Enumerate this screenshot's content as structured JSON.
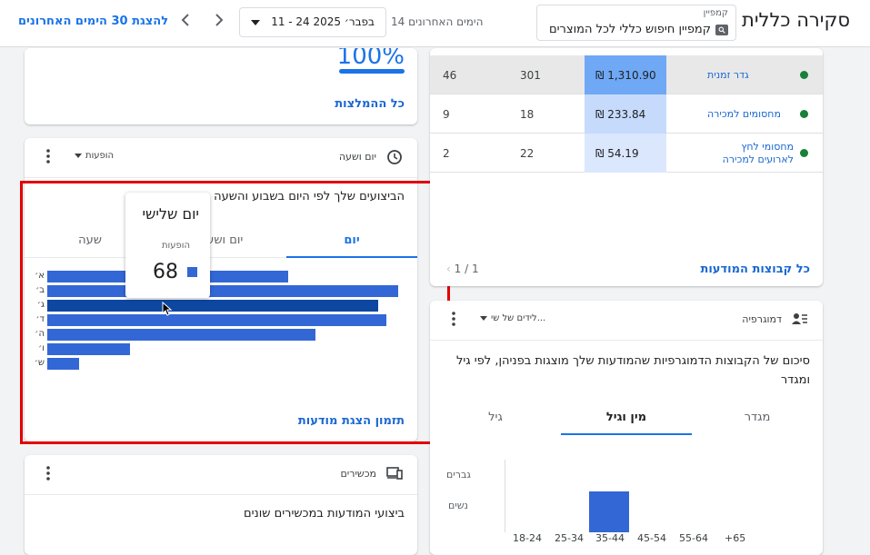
{
  "header": {
    "title": "סקירה כללית",
    "campaign_caption": "קמפיין",
    "campaign_value": "קמפיין חיפוש כללי לכל המוצרים",
    "range_caption": "14 הימים האחרונים",
    "date_range": "11 - 24 בפבר׳ 2025",
    "last30_link": "להצגת 30 הימים האחרונים"
  },
  "card_optimization": {
    "value": "100%",
    "link": "כל ההמלצות"
  },
  "card_schedule": {
    "header_title": "יום ושעה",
    "metric_select": "הופעות",
    "title": "הביצועים שלך לפי היום בשבוע והשעה",
    "tabs": [
      "יום",
      "יום ושעה",
      "שעה"
    ],
    "tooltip": {
      "title": "יום שלישי",
      "label": "הופעות",
      "value": "68"
    },
    "link": "תזמון הצגת מודעות"
  },
  "chart_data": {
    "type": "bar",
    "orientation": "horizontal",
    "categories": [
      "א׳",
      "ב׳",
      "ג׳",
      "ד׳",
      "ה׳",
      "ו׳",
      "ש׳"
    ],
    "values": [
      61,
      89,
      84,
      86,
      68,
      21,
      8
    ],
    "series": [
      {
        "name": "הופעות",
        "values": [
          61,
          89,
          84,
          86,
          68,
          21,
          8
        ]
      }
    ],
    "highlighted_index": 2,
    "color": "#3367d6",
    "highlight_color": "#0d47a1"
  },
  "card_devices": {
    "header_title": "מכשירים",
    "title": "ביצועי המודעות במכשירים שונים"
  },
  "card_adgroups": {
    "rows": [
      {
        "name": "גדר זמנית",
        "cost": "₪ 1,310.90",
        "col2": "301",
        "col1": "46",
        "cost_color": "#6fa8f5"
      },
      {
        "name": "מחסומים למכירה",
        "cost": "₪ 233.84",
        "col2": "18",
        "col1": "9",
        "cost_color": "#c6dafc"
      },
      {
        "name": "מחסומי לחץ לארועים למכירה",
        "cost": "₪ 54.19",
        "col2": "22",
        "col1": "2",
        "cost_color": "#dbe7fd"
      }
    ],
    "pager": "1 / 1",
    "link": "כל קבוצות המודעות"
  },
  "card_demographics": {
    "header_title": "דמוגרפיה",
    "metric_select": "לידים של שי...",
    "title": "סיכום של הקבוצות הדמוגרפיות שהמודעות שלך מוצגות בפניהן, לפי גיל ומגדר",
    "tabs": [
      "מגדר",
      "מין וגיל",
      "גיל"
    ],
    "gender_labels": [
      "גברים",
      "נשים"
    ],
    "age_labels": [
      "18-24",
      "25-34",
      "35-44",
      "45-54",
      "55-64",
      "+65"
    ]
  }
}
